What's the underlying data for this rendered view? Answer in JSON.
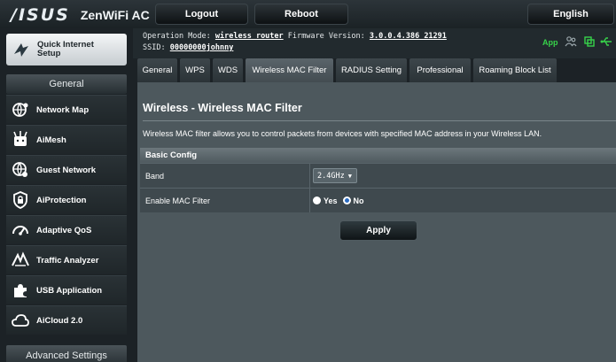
{
  "header": {
    "brand": "/ISUS",
    "model": "ZenWiFi AC",
    "logout_label": "Logout",
    "reboot_label": "Reboot",
    "language": "English"
  },
  "info": {
    "operation_mode_label": "Operation Mode:",
    "operation_mode": "wireless router",
    "firmware_label": "Firmware Version:",
    "firmware": "3.0.0.4.386_21291",
    "ssid_label": "SSID:",
    "ssid": "00000000johnny",
    "app_label": "App"
  },
  "sidebar": {
    "quick_setup": "Quick Internet Setup",
    "general_header": "General",
    "items": [
      {
        "label": "Network Map",
        "icon": "globe-network-icon"
      },
      {
        "label": "AiMesh",
        "icon": "aimesh-icon"
      },
      {
        "label": "Guest Network",
        "icon": "guest-network-icon"
      },
      {
        "label": "AiProtection",
        "icon": "lock-shield-icon"
      },
      {
        "label": "Adaptive QoS",
        "icon": "gauge-icon"
      },
      {
        "label": "Traffic Analyzer",
        "icon": "traffic-analyzer-icon"
      },
      {
        "label": "USB Application",
        "icon": "puzzle-icon"
      },
      {
        "label": "AiCloud 2.0",
        "icon": "cloud-icon"
      }
    ],
    "advanced_header": "Advanced Settings"
  },
  "tabs": [
    {
      "label": "General"
    },
    {
      "label": "WPS"
    },
    {
      "label": "WDS"
    },
    {
      "label": "Wireless MAC Filter",
      "active": true
    },
    {
      "label": "RADIUS Setting"
    },
    {
      "label": "Professional"
    },
    {
      "label": "Roaming Block List"
    }
  ],
  "main": {
    "title": "Wireless - Wireless MAC Filter",
    "description": "Wireless MAC filter allows you to control packets from devices with specified MAC address in your Wireless LAN.",
    "section_header": "Basic Config",
    "band_label": "Band",
    "band_value": "2.4GHz",
    "enable_label": "Enable MAC Filter",
    "yes_label": "Yes",
    "no_label": "No",
    "enable_selected": "No",
    "apply_label": "Apply"
  },
  "colors": {
    "background": "#1c2226",
    "content": "#4d585d",
    "accent_green": "#37d24a",
    "radio_selected": "#2c6cc2"
  }
}
